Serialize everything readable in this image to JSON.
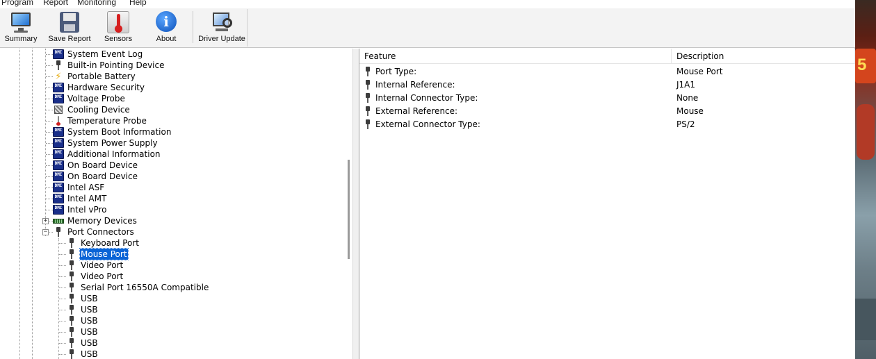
{
  "menu": [
    "Program",
    "Report",
    "Monitoring",
    "Help"
  ],
  "toolbar": [
    {
      "label": "Summary",
      "icon": "monitor-icon"
    },
    {
      "label": "Save Report",
      "icon": "floppy-disk-icon"
    },
    {
      "label": "Sensors",
      "icon": "thermometer-icon"
    },
    {
      "label": "About",
      "icon": "info-icon"
    },
    {
      "label": "Driver Update",
      "icon": "driver-update-icon"
    }
  ],
  "tree": {
    "items": [
      {
        "label": "System Event Log",
        "icon": "dmi"
      },
      {
        "label": "Built-in Pointing Device",
        "icon": "plug"
      },
      {
        "label": "Portable Battery",
        "icon": "bolt"
      },
      {
        "label": "Hardware Security",
        "icon": "dmi"
      },
      {
        "label": "Voltage Probe",
        "icon": "dmi"
      },
      {
        "label": "Cooling Device",
        "icon": "fan"
      },
      {
        "label": "Temperature Probe",
        "icon": "thermometer"
      },
      {
        "label": "System Boot Information",
        "icon": "dmi"
      },
      {
        "label": "System Power Supply",
        "icon": "dmi"
      },
      {
        "label": "Additional Information",
        "icon": "dmi"
      },
      {
        "label": "On Board Device",
        "icon": "dmi"
      },
      {
        "label": "On Board Device",
        "icon": "dmi"
      },
      {
        "label": "Intel ASF",
        "icon": "dmi"
      },
      {
        "label": "Intel AMT",
        "icon": "dmi"
      },
      {
        "label": "Intel vPro",
        "icon": "dmi"
      },
      {
        "label": "Memory Devices",
        "icon": "memory",
        "expander": "+"
      },
      {
        "label": "Port Connectors",
        "icon": "plug",
        "expander": "-"
      }
    ],
    "children": [
      {
        "label": "Keyboard Port"
      },
      {
        "label": "Mouse Port",
        "selected": true
      },
      {
        "label": "Video Port"
      },
      {
        "label": "Video Port"
      },
      {
        "label": "Serial Port 16550A Compatible"
      },
      {
        "label": "USB"
      },
      {
        "label": "USB"
      },
      {
        "label": "USB"
      },
      {
        "label": "USB"
      },
      {
        "label": "USB"
      },
      {
        "label": "USB"
      }
    ]
  },
  "details": {
    "columns": [
      "Feature",
      "Description"
    ],
    "rows": [
      {
        "feature": "Port Type:",
        "value": "Mouse Port"
      },
      {
        "feature": "Internal Reference:",
        "value": "J1A1"
      },
      {
        "feature": "Internal Connector Type:",
        "value": "None"
      },
      {
        "feature": "External Reference:",
        "value": "Mouse"
      },
      {
        "feature": "External Connector Type:",
        "value": "PS/2"
      }
    ]
  },
  "colors": {
    "selection": "#0a64d6",
    "dmi_icon": "#1a2f8a"
  }
}
